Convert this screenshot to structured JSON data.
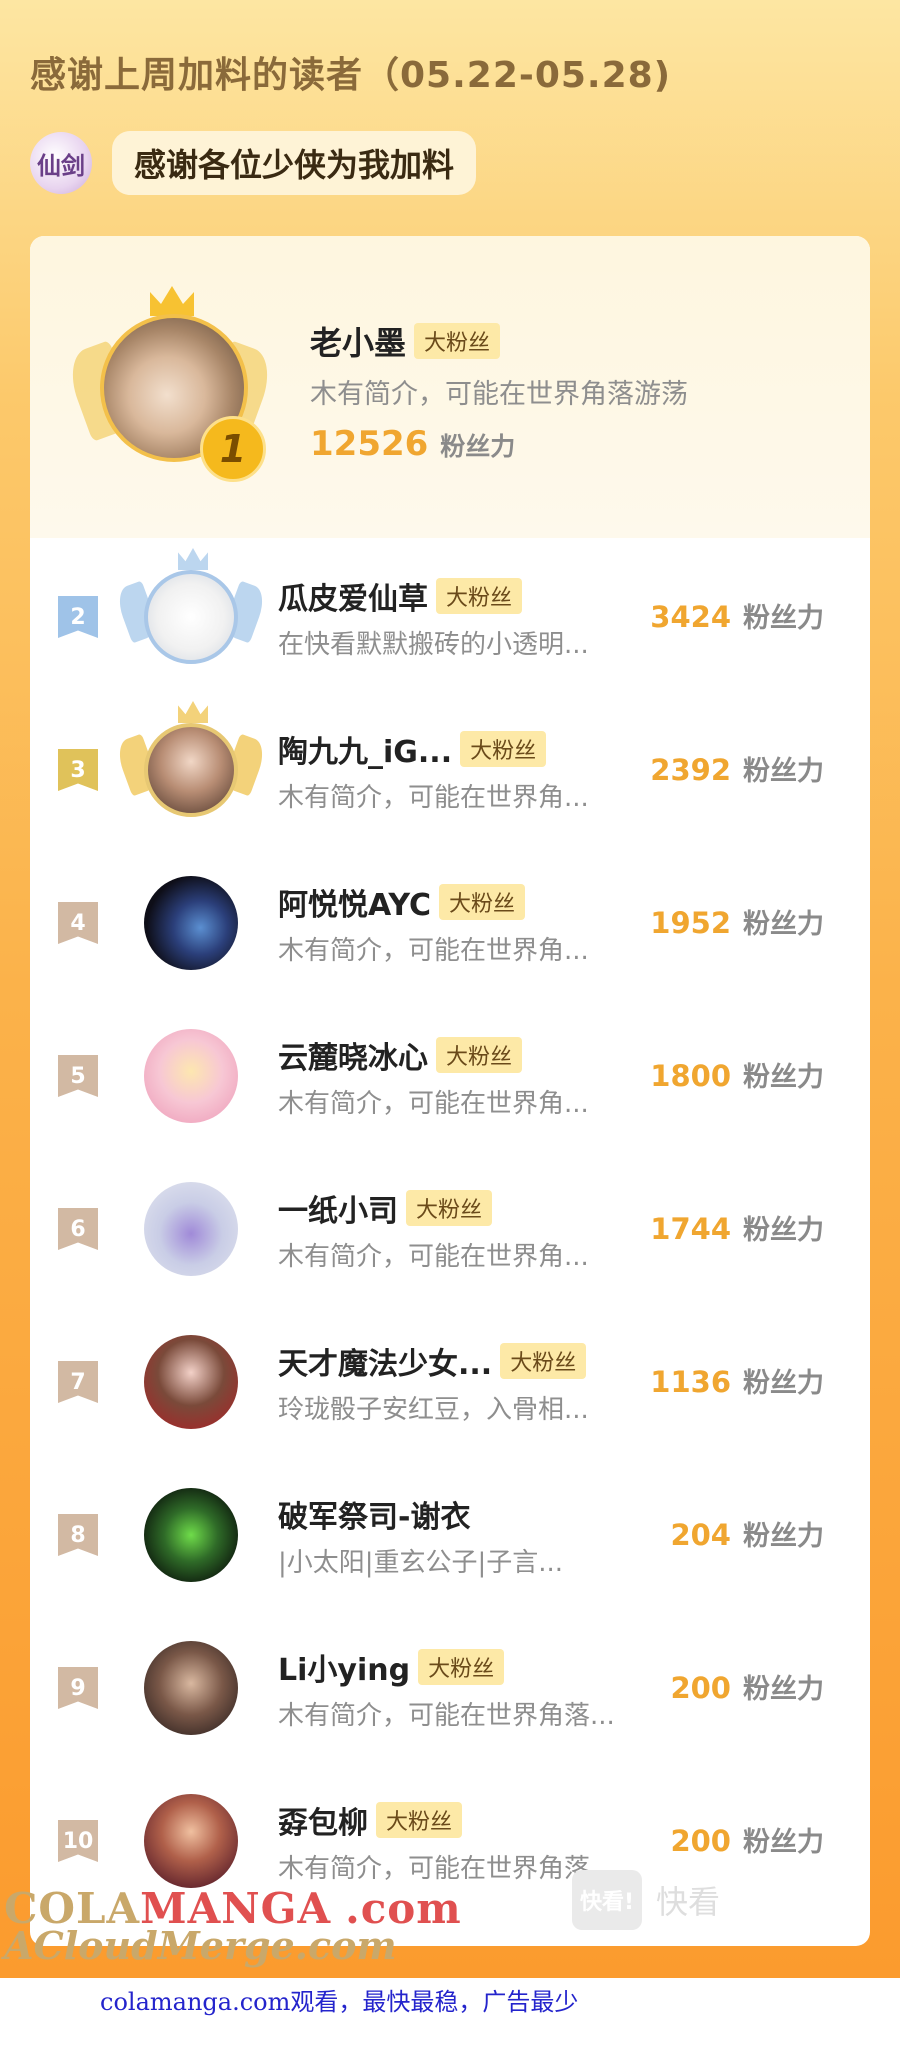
{
  "header": {
    "title": "感谢上周加料的读者（05.22-05.28)",
    "logo_text": "仙剑",
    "subtitle": "感谢各位少侠为我加料"
  },
  "top_fan": {
    "rank": "1",
    "name": "老小墨",
    "tag": "大粉丝",
    "desc": "木有简介，可能在世界角落游荡",
    "power": "12526",
    "power_label": "粉丝力"
  },
  "fans": [
    {
      "rank": "2",
      "name": "瓜皮爱仙草",
      "tag": "大粉丝",
      "desc": "在快看默默搬砖的小透明...",
      "power": "3424",
      "power_label": "粉丝力"
    },
    {
      "rank": "3",
      "name": "陶九九_iG...",
      "tag": "大粉丝",
      "desc": "木有简介，可能在世界角...",
      "power": "2392",
      "power_label": "粉丝力"
    },
    {
      "rank": "4",
      "name": "阿悦悦AYC",
      "tag": "大粉丝",
      "desc": "木有简介，可能在世界角...",
      "power": "1952",
      "power_label": "粉丝力"
    },
    {
      "rank": "5",
      "name": "云麓晓冰心",
      "tag": "大粉丝",
      "desc": "木有简介，可能在世界角...",
      "power": "1800",
      "power_label": "粉丝力"
    },
    {
      "rank": "6",
      "name": "一纸小司",
      "tag": "大粉丝",
      "desc": "木有简介，可能在世界角...",
      "power": "1744",
      "power_label": "粉丝力"
    },
    {
      "rank": "7",
      "name": "天才魔法少女...",
      "tag": "大粉丝",
      "desc": "玲珑骰子安红豆，入骨相...",
      "power": "1136",
      "power_label": "粉丝力"
    },
    {
      "rank": "8",
      "name": "破军祭司-谢衣",
      "tag": "",
      "desc": "|小太阳|重玄公子|子言...",
      "power": "204",
      "power_label": "粉丝力"
    },
    {
      "rank": "9",
      "name": "Li小ying",
      "tag": "大粉丝",
      "desc": "木有简介，可能在世界角落...",
      "power": "200",
      "power_label": "粉丝力"
    },
    {
      "rank": "10",
      "name": "孬包柳",
      "tag": "大粉丝",
      "desc": "木有简介，可能在世界角落...",
      "power": "200",
      "power_label": "粉丝力"
    }
  ],
  "watermark": {
    "box": "快看!",
    "text": "快看"
  },
  "brand": {
    "part1": "COLA",
    "part2": "MANGA",
    "part3": ".com",
    "line2": "ACloudMerge.com"
  },
  "footer": "colamanga.com观看，最快最稳，广告最少",
  "colors": {
    "accent": "#f0a630",
    "rank2": "#9fc3e8",
    "rank3": "#e0c25a",
    "rank_other": "#d2b9a3",
    "tag_bg": "#fde9a7"
  }
}
